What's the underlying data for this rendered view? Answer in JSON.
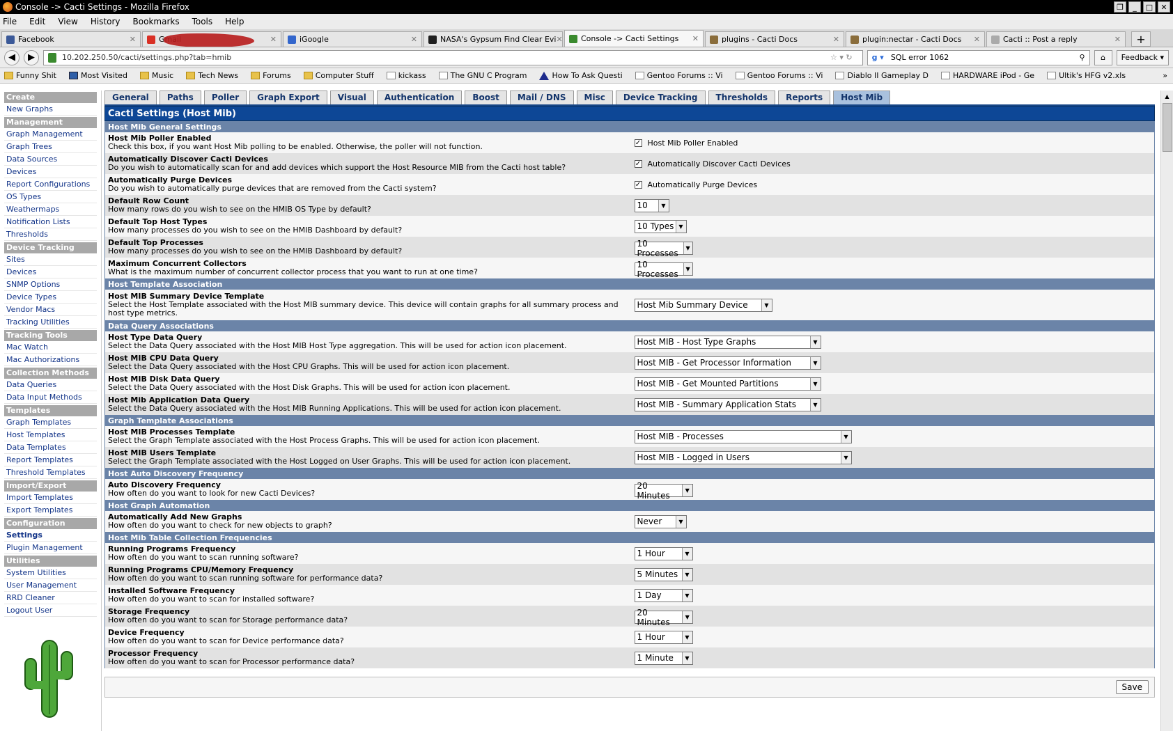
{
  "window": {
    "title": "Console -> Cacti Settings - Mozilla Firefox"
  },
  "menu": [
    "File",
    "Edit",
    "View",
    "History",
    "Bookmarks",
    "Tools",
    "Help"
  ],
  "browser_tabs": [
    {
      "label": "Facebook",
      "color": "#3b5998"
    },
    {
      "label": "Gmail",
      "color": "#d93025"
    },
    {
      "label": "iGoogle",
      "color": "#3366cc"
    },
    {
      "label": "NASA's Gypsum Find Clear Evi",
      "color": "#1f1f1f"
    },
    {
      "label": "Console -> Cacti Settings",
      "color": "#3a8a2e"
    },
    {
      "label": "plugins - Cacti Docs",
      "color": "#8a6d3b"
    },
    {
      "label": "plugin:nectar - Cacti Docs",
      "color": "#8a6d3b"
    },
    {
      "label": "Cacti :: Post a reply",
      "color": "#aaaaaa"
    }
  ],
  "nav": {
    "url": "10.202.250.50/cacti/settings.php?tab=hmib",
    "search": "SQL error 1062",
    "feedback": "Feedback"
  },
  "bookmarks": [
    "Funny Shit",
    "Most Visited",
    "Music",
    "Tech News",
    "Forums",
    "Computer Stuff",
    "kickass",
    "The GNU C Program",
    "How To Ask Questi",
    "Gentoo Forums :: Vi",
    "Gentoo Forums :: Vi",
    "Diablo II Gameplay D",
    "HARDWARE iPod - Ge",
    "Ultik's HFG v2.xls"
  ],
  "sidebar": [
    {
      "type": "section",
      "label": "Create"
    },
    {
      "type": "link",
      "label": "New Graphs"
    },
    {
      "type": "section",
      "label": "Management"
    },
    {
      "type": "link",
      "label": "Graph Management"
    },
    {
      "type": "link",
      "label": "Graph Trees"
    },
    {
      "type": "link",
      "label": "Data Sources"
    },
    {
      "type": "link",
      "label": "Devices"
    },
    {
      "type": "link",
      "label": "Report Configurations"
    },
    {
      "type": "link",
      "label": "OS Types"
    },
    {
      "type": "link",
      "label": "Weathermaps"
    },
    {
      "type": "link",
      "label": "Notification Lists"
    },
    {
      "type": "link",
      "label": "Thresholds"
    },
    {
      "type": "section",
      "label": "Device Tracking"
    },
    {
      "type": "link",
      "label": "Sites"
    },
    {
      "type": "link",
      "label": "Devices"
    },
    {
      "type": "link",
      "label": "SNMP Options"
    },
    {
      "type": "link",
      "label": "Device Types"
    },
    {
      "type": "link",
      "label": "Vendor Macs"
    },
    {
      "type": "link",
      "label": "Tracking Utilities"
    },
    {
      "type": "section",
      "label": "Tracking Tools"
    },
    {
      "type": "link",
      "label": "Mac Watch"
    },
    {
      "type": "link",
      "label": "Mac Authorizations"
    },
    {
      "type": "section",
      "label": "Collection Methods"
    },
    {
      "type": "link",
      "label": "Data Queries"
    },
    {
      "type": "link",
      "label": "Data Input Methods"
    },
    {
      "type": "section",
      "label": "Templates"
    },
    {
      "type": "link",
      "label": "Graph Templates"
    },
    {
      "type": "link",
      "label": "Host Templates"
    },
    {
      "type": "link",
      "label": "Data Templates"
    },
    {
      "type": "link",
      "label": "Report Templates"
    },
    {
      "type": "link",
      "label": "Threshold Templates"
    },
    {
      "type": "section",
      "label": "Import/Export"
    },
    {
      "type": "link",
      "label": "Import Templates"
    },
    {
      "type": "link",
      "label": "Export Templates"
    },
    {
      "type": "section",
      "label": "Configuration"
    },
    {
      "type": "link",
      "label": "Settings",
      "active": true
    },
    {
      "type": "link",
      "label": "Plugin Management"
    },
    {
      "type": "section",
      "label": "Utilities"
    },
    {
      "type": "link",
      "label": "System Utilities"
    },
    {
      "type": "link",
      "label": "User Management"
    },
    {
      "type": "link",
      "label": "RRD Cleaner"
    },
    {
      "type": "link",
      "label": "Logout User"
    }
  ],
  "tabs": [
    {
      "label": "General"
    },
    {
      "label": "Paths"
    },
    {
      "label": "Poller"
    },
    {
      "label": "Graph Export"
    },
    {
      "label": "Visual"
    },
    {
      "label": "Authentication"
    },
    {
      "label": "Boost"
    },
    {
      "label": "Mail / DNS"
    },
    {
      "label": "Misc"
    },
    {
      "label": "Device Tracking"
    },
    {
      "label": "Thresholds"
    },
    {
      "label": "Reports"
    },
    {
      "label": "Host Mib",
      "active": true
    }
  ],
  "settings_title": "Cacti Settings (Host Mib)",
  "sections": [
    {
      "title": "Host Mib General Settings",
      "rows": [
        {
          "name": "Host Mib Poller Enabled",
          "desc": "Check this box, if you want Host Mib polling to be enabled. Otherwise, the poller will not function.",
          "type": "checkbox",
          "checked": true,
          "label": "Host Mib Poller Enabled"
        },
        {
          "name": "Automatically Discover Cacti Devices",
          "desc": "Do you wish to automatically scan for and add devices which support the Host Resource MIB from the Cacti host table?",
          "type": "checkbox",
          "checked": true,
          "label": "Automatically Discover Cacti Devices"
        },
        {
          "name": "Automatically Purge Devices",
          "desc": "Do you wish to automatically purge devices that are removed from the Cacti system?",
          "type": "checkbox",
          "checked": true,
          "label": "Automatically Purge Devices"
        },
        {
          "name": "Default Row Count",
          "desc": "How many rows do you wish to see on the HMIB OS Type by default?",
          "type": "select",
          "value": "10",
          "size": "xs"
        },
        {
          "name": "Default Top Host Types",
          "desc": "How many processes do you wish to see on the HMIB Dashboard by default?",
          "type": "select",
          "value": "10 Types",
          "size": "s"
        },
        {
          "name": "Default Top Processes",
          "desc": "How many processes do you wish to see on the HMIB Dashboard by default?",
          "type": "select",
          "value": "10 Processes",
          "size": "m"
        },
        {
          "name": "Maximum Concurrent Collectors",
          "desc": "What is the maximum number of concurrent collector process that you want to run at one time?",
          "type": "select",
          "value": "10 Processes",
          "size": "m"
        }
      ]
    },
    {
      "title": "Host Template Association",
      "rows": [
        {
          "name": "Host MIB Summary Device Template",
          "desc": "Select the Host Template associated with the Host MIB summary device. This device will contain graphs for all summary process and host type metrics.",
          "type": "select",
          "value": "Host Mib Summary Device",
          "size": "l",
          "big": true
        }
      ]
    },
    {
      "title": "Data Query Associations",
      "rows": [
        {
          "name": "Host Type Data Query",
          "desc": "Select the Data Query associated with the Host MIB Host Type aggregation. This will be used for action icon placement.",
          "type": "select",
          "value": "Host MIB - Host Type Graphs",
          "size": "xl"
        },
        {
          "name": "Host MIB CPU Data Query",
          "desc": "Select the Data Query associated with the Host CPU Graphs. This will be used for action icon placement.",
          "type": "select",
          "value": "Host MIB - Get Processor Information",
          "size": "xl"
        },
        {
          "name": "Host MIB Disk Data Query",
          "desc": "Select the Data Query associated with the Host Disk Graphs. This will be used for action icon placement.",
          "type": "select",
          "value": "Host MIB - Get Mounted Partitions",
          "size": "xl"
        },
        {
          "name": "Host Mib Application Data Query",
          "desc": "Select the Data Query associated with the Host MIB Running Applications. This will be used for action icon placement.",
          "type": "select",
          "value": "Host MIB - Summary Application Stats",
          "size": "xl"
        }
      ]
    },
    {
      "title": "Graph Template Associations",
      "rows": [
        {
          "name": "Host MIB Processes Template",
          "desc": "Select the Graph Template associated with the Host Process Graphs. This will be used for action icon placement.",
          "type": "select",
          "value": "Host MIB - Processes",
          "size": "xxl"
        },
        {
          "name": "Host MIB Users Template",
          "desc": "Select the Graph Template associated with the Host Logged on User Graphs. This will be used for action icon placement.",
          "type": "select",
          "value": "Host MIB - Logged in Users",
          "size": "xxl"
        }
      ]
    },
    {
      "title": "Host Auto Discovery Frequency",
      "rows": [
        {
          "name": "Auto Discovery Frequency",
          "desc": "How often do you want to look for new Cacti Devices?",
          "type": "select",
          "value": "20 Minutes",
          "size": "m"
        }
      ]
    },
    {
      "title": "Host Graph Automation",
      "rows": [
        {
          "name": "Automatically Add New Graphs",
          "desc": "How often do you want to check for new objects to graph?",
          "type": "select",
          "value": "Never",
          "size": "s"
        }
      ]
    },
    {
      "title": "Host Mib Table Collection Frequencies",
      "rows": [
        {
          "name": "Running Programs Frequency",
          "desc": "How often do you want to scan running software?",
          "type": "select",
          "value": "1 Hour",
          "size": "m"
        },
        {
          "name": "Running Programs CPU/Memory Frequency",
          "desc": "How often do you want to scan running software for performance data?",
          "type": "select",
          "value": "5 Minutes",
          "size": "m"
        },
        {
          "name": "Installed Software Frequency",
          "desc": "How often do you want to scan for installed software?",
          "type": "select",
          "value": "1 Day",
          "size": "m"
        },
        {
          "name": "Storage Frequency",
          "desc": "How often do you want to scan for Storage performance data?",
          "type": "select",
          "value": "20 Minutes",
          "size": "m"
        },
        {
          "name": "Device Frequency",
          "desc": "How often do you want to scan for Device performance data?",
          "type": "select",
          "value": "1 Hour",
          "size": "m"
        },
        {
          "name": "Processor Frequency",
          "desc": "How often do you want to scan for Processor performance data?",
          "type": "select",
          "value": "1 Minute",
          "size": "m"
        }
      ]
    }
  ],
  "save_label": "Save",
  "colors": {
    "tab_active": "#a9c1de",
    "title_bar": "#0d4796",
    "section_header": "#6b84a8",
    "sidebar_section": "#a8a8a8",
    "link": "#113388"
  }
}
